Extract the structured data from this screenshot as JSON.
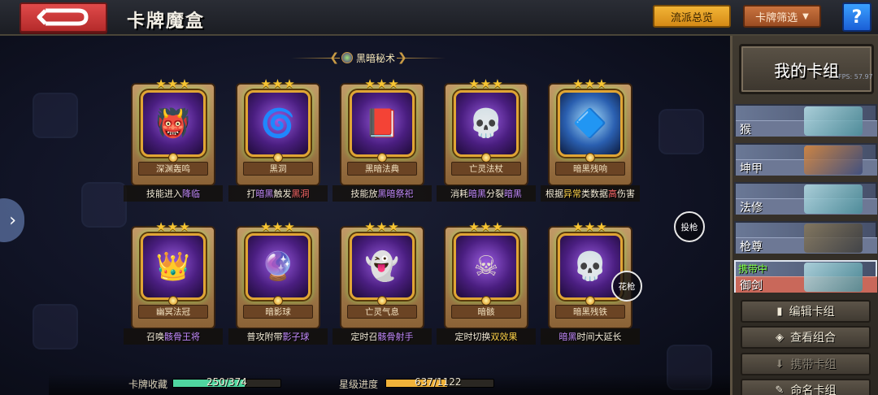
{
  "header": {
    "title": "卡牌魔盒",
    "overview_label": "流派总览",
    "filter_label": "卡牌筛选",
    "help_label": "?"
  },
  "category": {
    "label": "黑暗秘术"
  },
  "cards": [
    {
      "stars": "★★★",
      "name": "深渊轰鸣",
      "desc_parts": [
        "技能进入",
        "降临"
      ],
      "art": "👹"
    },
    {
      "stars": "★★★",
      "name": "黑洞",
      "desc_parts": [
        "打",
        "暗黑",
        "触发",
        "黑洞"
      ],
      "art": "🌀"
    },
    {
      "stars": "★★★",
      "name": "黑暗法典",
      "desc_parts": [
        "技能放",
        "黑暗祭祀"
      ],
      "art": "📕"
    },
    {
      "stars": "★★★",
      "name": "亡灵法杖",
      "desc_parts": [
        "消耗",
        "暗黑",
        "分裂",
        "暗黑"
      ],
      "art": "💀"
    },
    {
      "stars": "★★★",
      "name": "暗黑残响",
      "desc_parts": [
        "根据",
        "异常",
        "类数据",
        "高",
        "伤害"
      ],
      "art": "🔷"
    },
    {
      "stars": "★★★",
      "name": "幽冥法冠",
      "desc_parts": [
        "召唤",
        "骸骨王将"
      ],
      "art": "👑"
    },
    {
      "stars": "★★★",
      "name": "暗影球",
      "desc_parts": [
        "普攻附带",
        "影子球"
      ],
      "art": "🔮"
    },
    {
      "stars": "★★★",
      "name": "亡灵气息",
      "desc_parts": [
        "定时召",
        "骸骨射手"
      ],
      "art": "👻"
    },
    {
      "stars": "★★★",
      "name": "暗骸",
      "desc_parts": [
        "定时切换",
        "双效果"
      ],
      "art": "☠"
    },
    {
      "stars": "★★★",
      "name": "暗黑残铁",
      "desc_parts": [
        "暗黑",
        "时间大延长"
      ],
      "art": "💀"
    }
  ],
  "floating": {
    "throw_label": "投枪",
    "flower_label": "花枪"
  },
  "stats": {
    "collection_label": "卡牌收藏",
    "collection_value": "250/374",
    "collection_fraction": 0.668,
    "star_label": "星级进度",
    "star_value": "637/1122",
    "star_fraction": 0.568
  },
  "deck": {
    "title": "我的卡组",
    "fps": "FPS: 57.97",
    "items": [
      {
        "label": "猴"
      },
      {
        "label": "坤甲"
      },
      {
        "label": "法修"
      },
      {
        "label": "枪尊"
      },
      {
        "label": "御剑",
        "status": "携带中"
      }
    ],
    "actions": {
      "edit": "编辑卡组",
      "view": "查看组合",
      "carry": "携带卡组",
      "rename": "命名卡组"
    }
  },
  "colors": {
    "collection_bar": "#4fd6a0",
    "star_bar": "#f0b23a",
    "accent_gold": "#c79a45"
  }
}
